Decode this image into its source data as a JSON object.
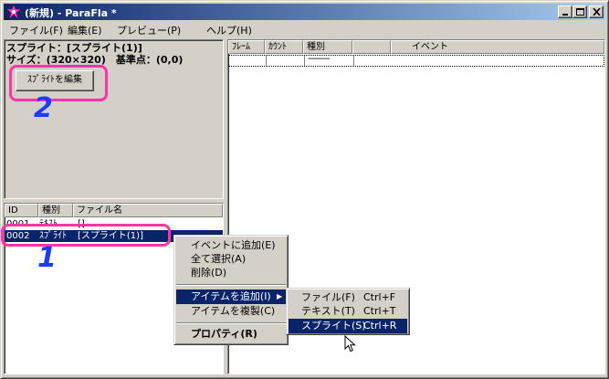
{
  "window": {
    "title": "(新規) - ParaFla *"
  },
  "menubar": {
    "items": [
      "ファイル(F)",
      "編集(E)",
      "プレビュー(P)",
      "ヘルプ(H)"
    ]
  },
  "sprite_panel": {
    "name_line": "スプライト：[スプライト(1)]",
    "size_line": "サイズ：(320×320)　基準点：(0,0)",
    "edit_button": "ｽﾌﾟﾗｲﾄを編集"
  },
  "item_list": {
    "headers": [
      "ID",
      "種別",
      "ファイル名"
    ],
    "rows": [
      {
        "id": "0001",
        "kind": "ﾃｷｽﾄ",
        "name": "[]"
      },
      {
        "id": "0002",
        "kind": "ｽﾌﾟﾗｲﾄ",
        "name": "[スプライト(1)]"
      }
    ]
  },
  "event_list": {
    "headers": [
      "ﾌﾚｰﾑ",
      "ｶｳﾝﾄ",
      "種別",
      "",
      "イベント"
    ],
    "row": {
      "frame": "",
      "count": "",
      "kind": "---------",
      "extra": "",
      "event": ""
    }
  },
  "context_menu": {
    "items": [
      "イベントに追加(E)",
      "全て選択(A)",
      "削除(D)",
      "アイテムを追加(I)",
      "アイテムを複製(C)",
      "プロパティ(R)"
    ]
  },
  "submenu": {
    "items": [
      {
        "label": "ファイル(F)",
        "accel": "Ctrl+F"
      },
      {
        "label": "テキスト(T)",
        "accel": "Ctrl+T"
      },
      {
        "label": "スプライト(S)",
        "accel": "Ctrl+R"
      }
    ]
  },
  "annotations": {
    "step1": "1",
    "step2": "2"
  },
  "colors": {
    "face": "#d4d0c8",
    "selection": "#0a246a",
    "annotation_pink": "#ff33aa",
    "annotation_blue": "#1a3cff"
  }
}
